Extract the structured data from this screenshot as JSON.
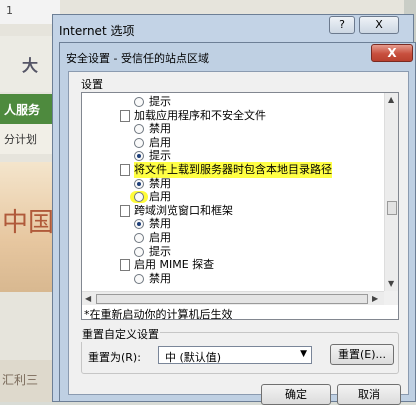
{
  "background_page": {
    "top_text": "1",
    "logo_text": "大",
    "nav_text": "人服务",
    "sub_text": "分计划",
    "banner_text": "中国",
    "bottom_text": "汇利三"
  },
  "outer_window": {
    "title": "Internet 选项",
    "help_button": "?",
    "close_button": "X"
  },
  "dialog": {
    "title": "安全设置 - 受信任的站点区域",
    "close_button": "X",
    "settings_label": "设置",
    "tree": [
      {
        "kind": "option",
        "label": "提示",
        "selected": false
      },
      {
        "kind": "header",
        "label": "加载应用程序和不安全文件"
      },
      {
        "kind": "option",
        "label": "禁用",
        "selected": false
      },
      {
        "kind": "option",
        "label": "启用",
        "selected": false
      },
      {
        "kind": "option",
        "label": "提示",
        "selected": true
      },
      {
        "kind": "header",
        "label": "将文件上载到服务器时包含本地目录路径",
        "highlighted": true
      },
      {
        "kind": "option",
        "label": "禁用",
        "selected": true
      },
      {
        "kind": "option",
        "label": "启用",
        "selected": false,
        "highlighted": true
      },
      {
        "kind": "header",
        "label": "跨域浏览窗口和框架"
      },
      {
        "kind": "option",
        "label": "禁用",
        "selected": true
      },
      {
        "kind": "option",
        "label": "启用",
        "selected": false
      },
      {
        "kind": "option",
        "label": "提示",
        "selected": false
      },
      {
        "kind": "header",
        "label": "启用 MIME 探查"
      },
      {
        "kind": "option",
        "label": "禁用",
        "selected": false
      }
    ],
    "restart_note": "*在重新启动你的计算机后生效",
    "reset_group_title": "重置自定义设置",
    "reset_to_label": "重置为(R):",
    "reset_to_value": "中 (默认值)",
    "reset_button": "重置(E)...",
    "ok_button": "确定",
    "cancel_button": "取消"
  },
  "colors": {
    "highlight": "#ffff44",
    "close_button": "#c8503e",
    "title_bar": "#bfd0e3"
  }
}
